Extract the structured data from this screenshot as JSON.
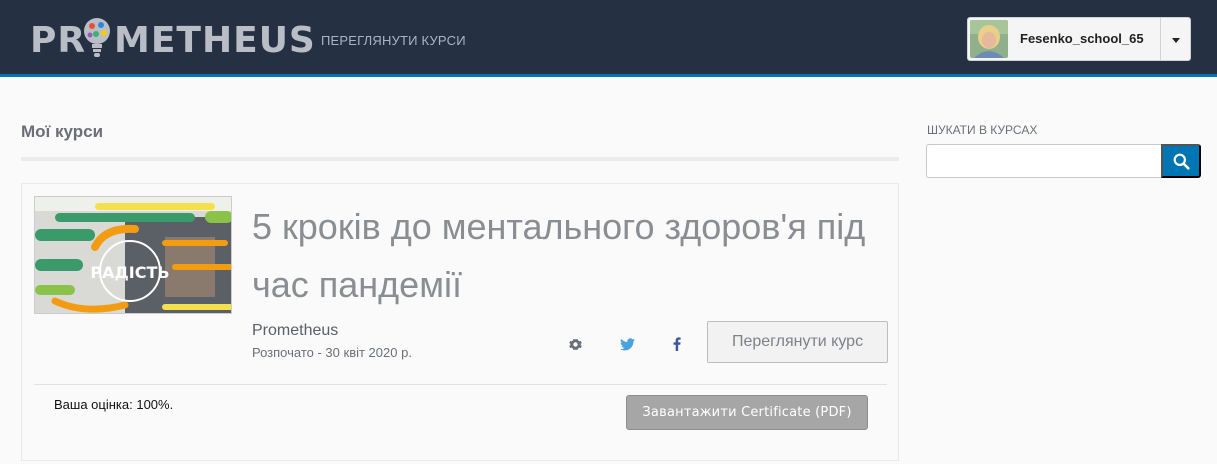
{
  "header": {
    "logo_text_left": "PR",
    "logo_text_right": "METHEUS",
    "nav_link": "ПЕРЕГЛЯНУТИ КУРСИ",
    "username": "Fesenko_school_65"
  },
  "main": {
    "section_title": "Мої курси",
    "course": {
      "title": "5 кроків до ментального здоров'я під час пандемії",
      "thumbnail_text": "РАДІСТЬ",
      "org": "Prometheus",
      "started": "Розпочато - 30 квіт 2020 р.",
      "view_button": "Переглянути курс",
      "grade": "Ваша оцінка: 100%.",
      "certificate_button": "Завантажити Certificate (PDF)"
    }
  },
  "sidebar": {
    "search_label": "ШУКАТИ В КУРСАХ",
    "search_value": ""
  },
  "icons": {
    "settings": "gear-icon",
    "twitter": "twitter-icon",
    "facebook": "facebook-icon",
    "search": "search-icon",
    "caret": "caret-down-icon"
  },
  "colors": {
    "header_bg": "#253142",
    "accent": "#0075b4"
  }
}
